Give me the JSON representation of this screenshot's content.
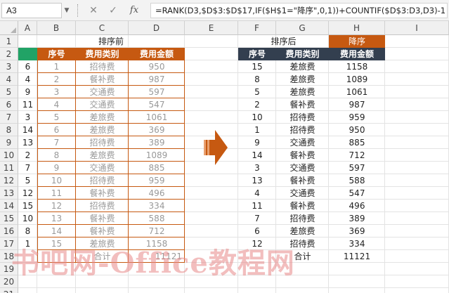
{
  "formula_bar": {
    "name_box": "A3",
    "cancel_icon": "✕",
    "enter_icon": "✓",
    "fx_label": "fx",
    "formula": "=RANK(D3,$D$3:$D$17,IF($H$1=\"降序\",0,1))+COUNTIF($D$3:D3,D3)-1"
  },
  "columns": [
    "A",
    "B",
    "C",
    "D",
    "E",
    "F",
    "G",
    "H",
    "I"
  ],
  "rows": [
    "1",
    "2",
    "3",
    "4",
    "5",
    "6",
    "7",
    "8",
    "9",
    "10",
    "11",
    "12",
    "13",
    "14",
    "15",
    "16",
    "17",
    "18",
    "19",
    "20",
    "21"
  ],
  "left_table": {
    "title": "排序前",
    "headers": [
      "序号",
      "费用类别",
      "费用金额"
    ],
    "rank": [
      "6",
      "4",
      "9",
      "11",
      "3",
      "14",
      "13",
      "2",
      "7",
      "5",
      "12",
      "15",
      "10",
      "8",
      "1"
    ],
    "rows": [
      [
        "1",
        "招待费",
        "950"
      ],
      [
        "2",
        "餐补费",
        "987"
      ],
      [
        "3",
        "交通费",
        "597"
      ],
      [
        "4",
        "交通费",
        "547"
      ],
      [
        "5",
        "差旅费",
        "1061"
      ],
      [
        "6",
        "差旅费",
        "369"
      ],
      [
        "7",
        "招待费",
        "389"
      ],
      [
        "8",
        "差旅费",
        "1089"
      ],
      [
        "9",
        "交通费",
        "885"
      ],
      [
        "10",
        "招待费",
        "959"
      ],
      [
        "11",
        "餐补费",
        "496"
      ],
      [
        "12",
        "招待费",
        "334"
      ],
      [
        "13",
        "餐补费",
        "588"
      ],
      [
        "14",
        "餐补费",
        "712"
      ],
      [
        "15",
        "差旅费",
        "1158"
      ]
    ],
    "total_label": "合计",
    "total_value": "11121"
  },
  "right_table": {
    "title": "排序后",
    "order_label": "降序",
    "headers": [
      "序号",
      "费用类别",
      "费用金额"
    ],
    "rows": [
      [
        "15",
        "差旅费",
        "1158"
      ],
      [
        "8",
        "差旅费",
        "1089"
      ],
      [
        "5",
        "差旅费",
        "1061"
      ],
      [
        "2",
        "餐补费",
        "987"
      ],
      [
        "10",
        "招待费",
        "959"
      ],
      [
        "1",
        "招待费",
        "950"
      ],
      [
        "9",
        "交通费",
        "885"
      ],
      [
        "14",
        "餐补费",
        "712"
      ],
      [
        "3",
        "交通费",
        "597"
      ],
      [
        "13",
        "餐补费",
        "588"
      ],
      [
        "4",
        "交通费",
        "547"
      ],
      [
        "11",
        "餐补费",
        "496"
      ],
      [
        "7",
        "招待费",
        "389"
      ],
      [
        "6",
        "差旅费",
        "369"
      ],
      [
        "12",
        "招待费",
        "334"
      ]
    ],
    "total_label": "合计",
    "total_value": "11121"
  },
  "arrow_icon": "right-arrow-icon",
  "watermark": "书吧网-Office教程网",
  "colors": {
    "accent_orange": "#c65911",
    "header_dark": "#333f4f",
    "excel_green": "#21a366"
  }
}
